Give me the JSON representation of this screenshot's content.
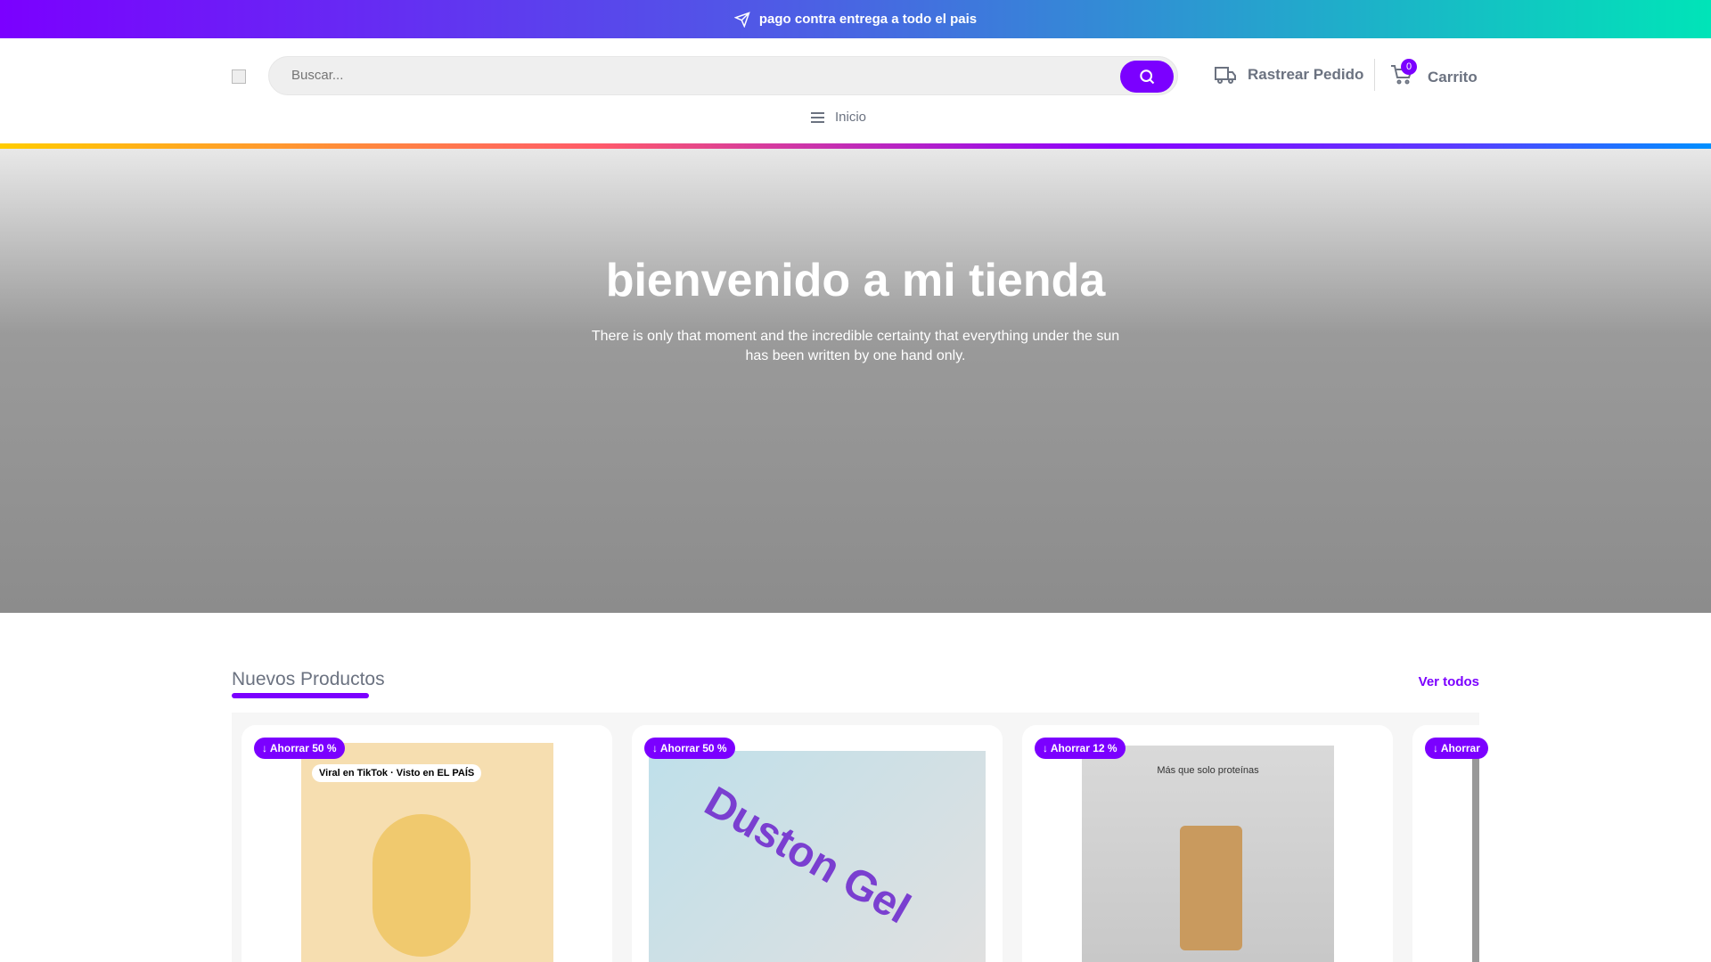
{
  "topbar": {
    "text": "pago contra entrega a todo el pais",
    "icon": "paper-plane-icon"
  },
  "header": {
    "search_placeholder": "Buscar...",
    "track_label": "Rastrear Pedido",
    "cart_label": "Carrito",
    "cart_count": "0"
  },
  "nav": {
    "home": "Inicio"
  },
  "hero": {
    "title": "bienvenido a mi tienda",
    "subtitle": "There is only that moment and the incredible certainty that everything under the sun has been written by one hand only."
  },
  "section": {
    "title": "Nuevos Productos",
    "see_all": "Ver todos"
  },
  "products": [
    {
      "discount": "Ahorrar 50 %",
      "image_text": "Viral en TikTok · Visto en EL PAÍS"
    },
    {
      "discount": "Ahorrar 50 %",
      "image_text": "Duston Gel"
    },
    {
      "discount": "Ahorrar 12 %",
      "image_text": "Más que solo proteínas"
    },
    {
      "discount": "Ahorrar"
    }
  ],
  "colors": {
    "accent": "#7b00ff"
  }
}
